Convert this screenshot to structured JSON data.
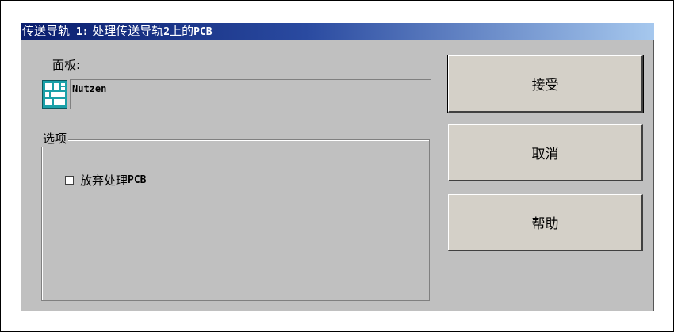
{
  "window": {
    "title_prefix": "传送导轨",
    "title_number": " 1:",
    "title_text": " 处理传送导轨",
    "title_number2": "2",
    "title_text2": "上的",
    "title_pcb": "PCB"
  },
  "panel": {
    "label": "面板:",
    "icon": "panel-board-icon",
    "value": "Nutzen"
  },
  "options": {
    "legend": "选项",
    "discard_label": "放弃处理",
    "discard_pcb": "PCB",
    "discard_checked": false
  },
  "buttons": {
    "accept": "接受",
    "cancel": "取消",
    "help": "帮助"
  },
  "colors": {
    "titlebar_dark": "#0a1e6e",
    "titlebar_light": "#a6c8ee",
    "dialog_bg": "#c0c0c0",
    "icon_teal": "#1aa0a8"
  }
}
